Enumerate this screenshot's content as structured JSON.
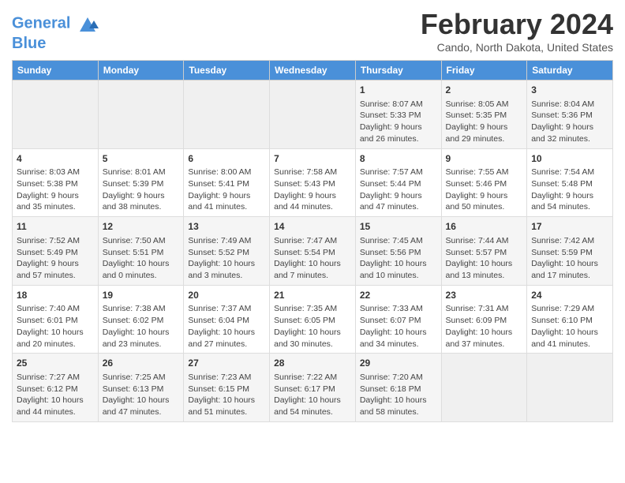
{
  "header": {
    "logo_line1": "General",
    "logo_line2": "Blue",
    "title": "February 2024",
    "location": "Cando, North Dakota, United States"
  },
  "days_of_week": [
    "Sunday",
    "Monday",
    "Tuesday",
    "Wednesday",
    "Thursday",
    "Friday",
    "Saturday"
  ],
  "weeks": [
    [
      {
        "day": "",
        "info": ""
      },
      {
        "day": "",
        "info": ""
      },
      {
        "day": "",
        "info": ""
      },
      {
        "day": "",
        "info": ""
      },
      {
        "day": "1",
        "info": "Sunrise: 8:07 AM\nSunset: 5:33 PM\nDaylight: 9 hours\nand 26 minutes."
      },
      {
        "day": "2",
        "info": "Sunrise: 8:05 AM\nSunset: 5:35 PM\nDaylight: 9 hours\nand 29 minutes."
      },
      {
        "day": "3",
        "info": "Sunrise: 8:04 AM\nSunset: 5:36 PM\nDaylight: 9 hours\nand 32 minutes."
      }
    ],
    [
      {
        "day": "4",
        "info": "Sunrise: 8:03 AM\nSunset: 5:38 PM\nDaylight: 9 hours\nand 35 minutes."
      },
      {
        "day": "5",
        "info": "Sunrise: 8:01 AM\nSunset: 5:39 PM\nDaylight: 9 hours\nand 38 minutes."
      },
      {
        "day": "6",
        "info": "Sunrise: 8:00 AM\nSunset: 5:41 PM\nDaylight: 9 hours\nand 41 minutes."
      },
      {
        "day": "7",
        "info": "Sunrise: 7:58 AM\nSunset: 5:43 PM\nDaylight: 9 hours\nand 44 minutes."
      },
      {
        "day": "8",
        "info": "Sunrise: 7:57 AM\nSunset: 5:44 PM\nDaylight: 9 hours\nand 47 minutes."
      },
      {
        "day": "9",
        "info": "Sunrise: 7:55 AM\nSunset: 5:46 PM\nDaylight: 9 hours\nand 50 minutes."
      },
      {
        "day": "10",
        "info": "Sunrise: 7:54 AM\nSunset: 5:48 PM\nDaylight: 9 hours\nand 54 minutes."
      }
    ],
    [
      {
        "day": "11",
        "info": "Sunrise: 7:52 AM\nSunset: 5:49 PM\nDaylight: 9 hours\nand 57 minutes."
      },
      {
        "day": "12",
        "info": "Sunrise: 7:50 AM\nSunset: 5:51 PM\nDaylight: 10 hours\nand 0 minutes."
      },
      {
        "day": "13",
        "info": "Sunrise: 7:49 AM\nSunset: 5:52 PM\nDaylight: 10 hours\nand 3 minutes."
      },
      {
        "day": "14",
        "info": "Sunrise: 7:47 AM\nSunset: 5:54 PM\nDaylight: 10 hours\nand 7 minutes."
      },
      {
        "day": "15",
        "info": "Sunrise: 7:45 AM\nSunset: 5:56 PM\nDaylight: 10 hours\nand 10 minutes."
      },
      {
        "day": "16",
        "info": "Sunrise: 7:44 AM\nSunset: 5:57 PM\nDaylight: 10 hours\nand 13 minutes."
      },
      {
        "day": "17",
        "info": "Sunrise: 7:42 AM\nSunset: 5:59 PM\nDaylight: 10 hours\nand 17 minutes."
      }
    ],
    [
      {
        "day": "18",
        "info": "Sunrise: 7:40 AM\nSunset: 6:01 PM\nDaylight: 10 hours\nand 20 minutes."
      },
      {
        "day": "19",
        "info": "Sunrise: 7:38 AM\nSunset: 6:02 PM\nDaylight: 10 hours\nand 23 minutes."
      },
      {
        "day": "20",
        "info": "Sunrise: 7:37 AM\nSunset: 6:04 PM\nDaylight: 10 hours\nand 27 minutes."
      },
      {
        "day": "21",
        "info": "Sunrise: 7:35 AM\nSunset: 6:05 PM\nDaylight: 10 hours\nand 30 minutes."
      },
      {
        "day": "22",
        "info": "Sunrise: 7:33 AM\nSunset: 6:07 PM\nDaylight: 10 hours\nand 34 minutes."
      },
      {
        "day": "23",
        "info": "Sunrise: 7:31 AM\nSunset: 6:09 PM\nDaylight: 10 hours\nand 37 minutes."
      },
      {
        "day": "24",
        "info": "Sunrise: 7:29 AM\nSunset: 6:10 PM\nDaylight: 10 hours\nand 41 minutes."
      }
    ],
    [
      {
        "day": "25",
        "info": "Sunrise: 7:27 AM\nSunset: 6:12 PM\nDaylight: 10 hours\nand 44 minutes."
      },
      {
        "day": "26",
        "info": "Sunrise: 7:25 AM\nSunset: 6:13 PM\nDaylight: 10 hours\nand 47 minutes."
      },
      {
        "day": "27",
        "info": "Sunrise: 7:23 AM\nSunset: 6:15 PM\nDaylight: 10 hours\nand 51 minutes."
      },
      {
        "day": "28",
        "info": "Sunrise: 7:22 AM\nSunset: 6:17 PM\nDaylight: 10 hours\nand 54 minutes."
      },
      {
        "day": "29",
        "info": "Sunrise: 7:20 AM\nSunset: 6:18 PM\nDaylight: 10 hours\nand 58 minutes."
      },
      {
        "day": "",
        "info": ""
      },
      {
        "day": "",
        "info": ""
      }
    ]
  ]
}
